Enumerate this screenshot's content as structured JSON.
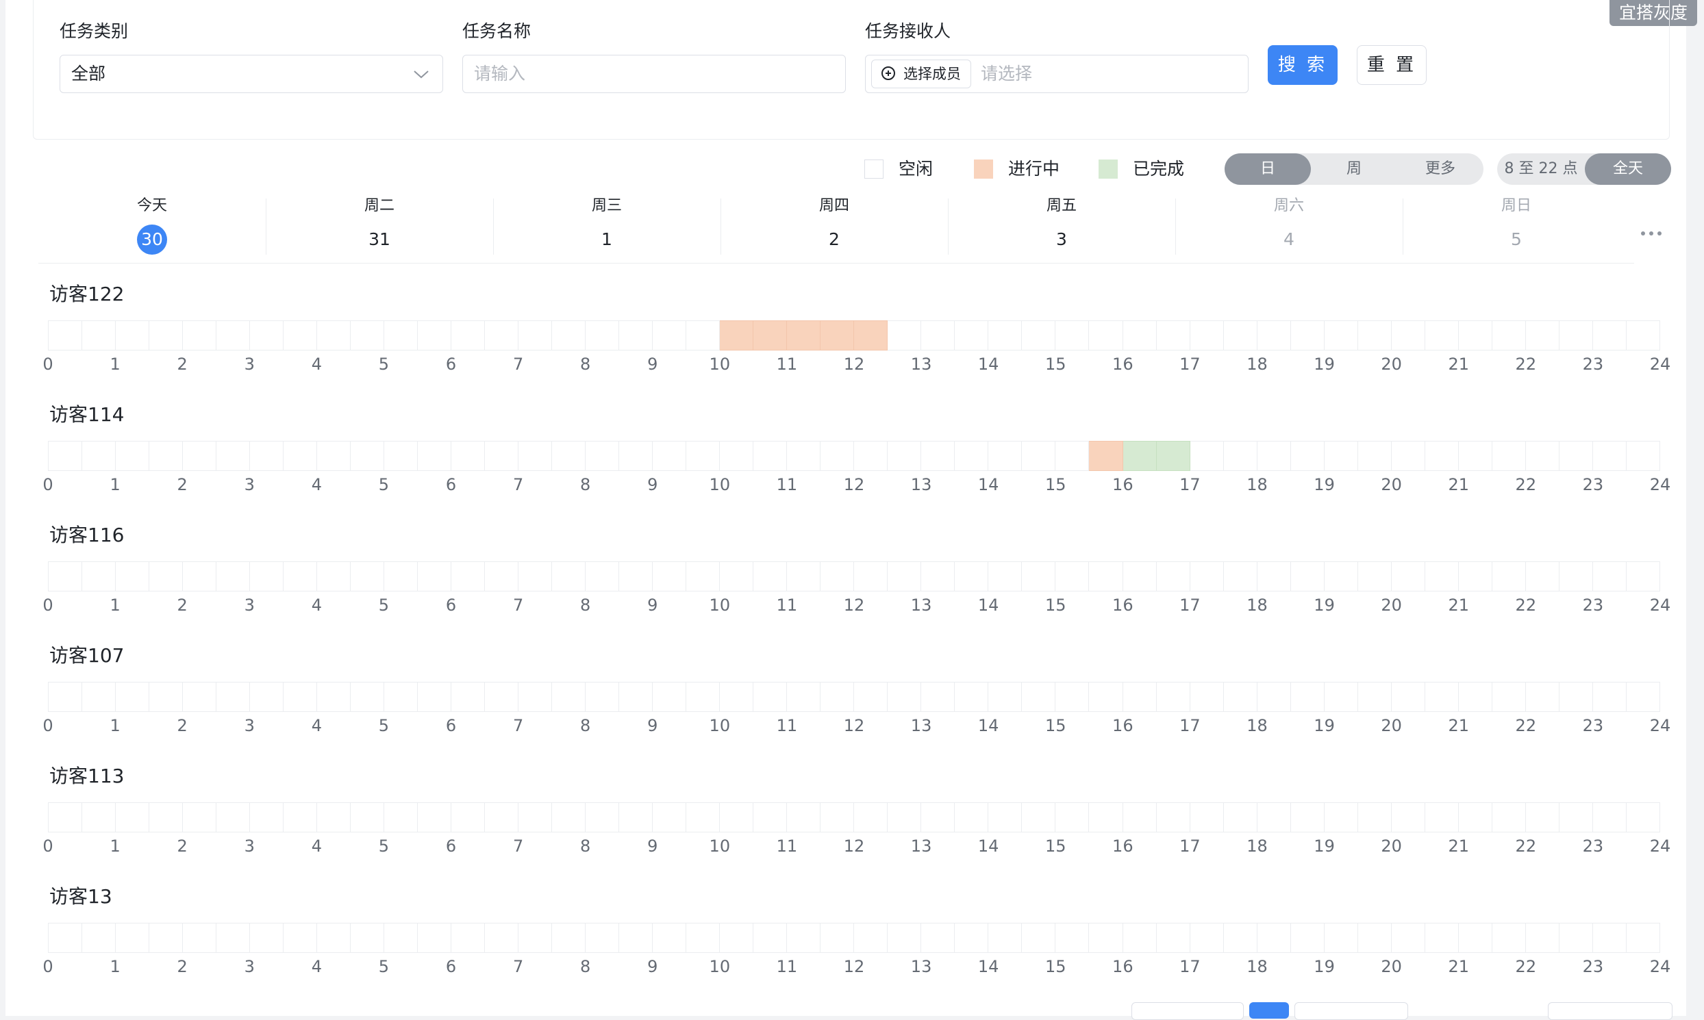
{
  "gray_tag": "宜搭灰度",
  "filters": {
    "category_label": "任务类别",
    "category_value": "全部",
    "name_label": "任务名称",
    "name_placeholder": "请输入",
    "receiver_label": "任务接收人",
    "member_button": "选择成员",
    "receiver_placeholder": "请选择",
    "search_button": "搜 索",
    "reset_button": "重 置"
  },
  "legend": [
    {
      "label": "空闲",
      "color": "#ffffff"
    },
    {
      "label": "进行中",
      "color": "#f9d3bc"
    },
    {
      "label": "已完成",
      "color": "#d6ead2"
    }
  ],
  "view_modes": [
    {
      "label": "日",
      "active": true
    },
    {
      "label": "周",
      "active": false
    },
    {
      "label": "更多",
      "active": false
    }
  ],
  "hour_ranges": [
    {
      "label": "8 至 22 点",
      "active": false
    },
    {
      "label": "全天",
      "active": true
    }
  ],
  "days": [
    {
      "name": "今天",
      "num": "30",
      "state": "today"
    },
    {
      "name": "周二",
      "num": "31",
      "state": "normal"
    },
    {
      "name": "周三",
      "num": "1",
      "state": "normal"
    },
    {
      "name": "周四",
      "num": "2",
      "state": "normal"
    },
    {
      "name": "周五",
      "num": "3",
      "state": "normal"
    },
    {
      "name": "周六",
      "num": "4",
      "state": "weekend"
    },
    {
      "name": "周日",
      "num": "5",
      "state": "weekend"
    }
  ],
  "hour_ticks": [
    "0",
    "1",
    "2",
    "3",
    "4",
    "5",
    "6",
    "7",
    "8",
    "9",
    "10",
    "11",
    "12",
    "13",
    "14",
    "15",
    "16",
    "17",
    "18",
    "19",
    "20",
    "21",
    "22",
    "23",
    "24"
  ],
  "visitors": [
    {
      "name": "访客122",
      "busy": [
        20,
        21,
        22,
        23,
        24
      ],
      "done": []
    },
    {
      "name": "访客114",
      "busy": [
        31
      ],
      "done": [
        32,
        33
      ]
    },
    {
      "name": "访客116",
      "busy": [],
      "done": []
    },
    {
      "name": "访客107",
      "busy": [],
      "done": []
    },
    {
      "name": "访客113",
      "busy": [],
      "done": []
    },
    {
      "name": "访客13",
      "busy": [],
      "done": []
    }
  ]
}
